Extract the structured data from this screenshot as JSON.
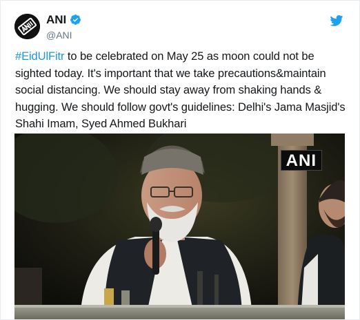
{
  "tweet": {
    "display_name": "ANI",
    "handle": "@ANI",
    "hashtag": "#EidUlFitr",
    "body": " to be celebrated on May 25 as moon could not be sighted today. It's important that we take precautions&maintain social distancing. We should stay away from shaking hands & hugging. We should follow govt's guidelines: Delhi's Jama Masjid's Shahi Imam, Syed Ahmed Bukhari"
  },
  "media": {
    "watermark": "ANI"
  },
  "icons": {
    "avatar": "ani-logo-avatar",
    "verified": "verified-badge-icon",
    "brand": "twitter-bird-icon"
  },
  "colors": {
    "link": "#1b95e0",
    "verified": "#1da1f2",
    "twitter_brand": "#1da1f2",
    "text": "#14171a",
    "muted": "#657786"
  }
}
